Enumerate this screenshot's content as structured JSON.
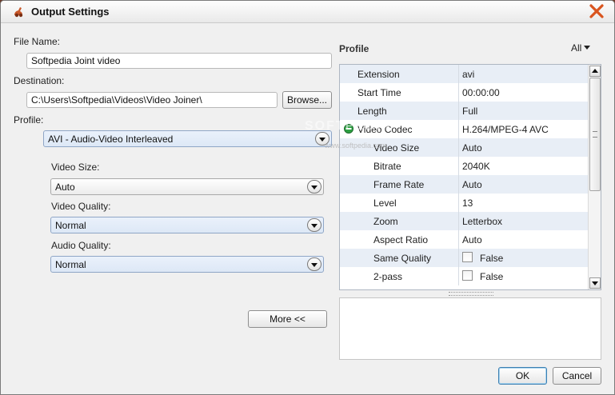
{
  "window": {
    "title": "Output Settings"
  },
  "form": {
    "file_name_label": "File Name:",
    "file_name_value": "Softpedia Joint video",
    "destination_label": "Destination:",
    "destination_value": "C:\\Users\\Softpedia\\Videos\\Video Joiner\\",
    "browse_label": "Browse...",
    "profile_label": "Profile:",
    "profile_value": "AVI - Audio-Video Interleaved",
    "video_size_label": "Video Size:",
    "video_size_value": "Auto",
    "video_quality_label": "Video Quality:",
    "video_quality_value": "Normal",
    "audio_quality_label": "Audio Quality:",
    "audio_quality_value": "Normal",
    "more_label": "More <<"
  },
  "profile_panel": {
    "heading": "Profile",
    "filter_value": "All",
    "rows": [
      {
        "key": "Extension",
        "value": "avi"
      },
      {
        "key": "Start Time",
        "value": "00:00:00"
      },
      {
        "key": "Length",
        "value": "Full"
      },
      {
        "key": "Video Codec",
        "value": "H.264/MPEG-4 AVC"
      },
      {
        "key": "Video Size",
        "value": "Auto"
      },
      {
        "key": "Bitrate",
        "value": "2040K"
      },
      {
        "key": "Frame Rate",
        "value": "Auto"
      },
      {
        "key": "Level",
        "value": "13"
      },
      {
        "key": "Zoom",
        "value": "Letterbox"
      },
      {
        "key": "Aspect Ratio",
        "value": "Auto"
      },
      {
        "key": "Same Quality",
        "value": "False"
      },
      {
        "key": "2-pass",
        "value": "False"
      }
    ]
  },
  "buttons": {
    "ok_label": "OK",
    "cancel_label": "Cancel"
  },
  "watermark": {
    "text": "SOFTPEDIA",
    "sub": "www.softpedia.com"
  },
  "colors": {
    "accent": "#3c7fb1",
    "close_icon": "#d9541e",
    "row_alt": "#e8eef6"
  }
}
